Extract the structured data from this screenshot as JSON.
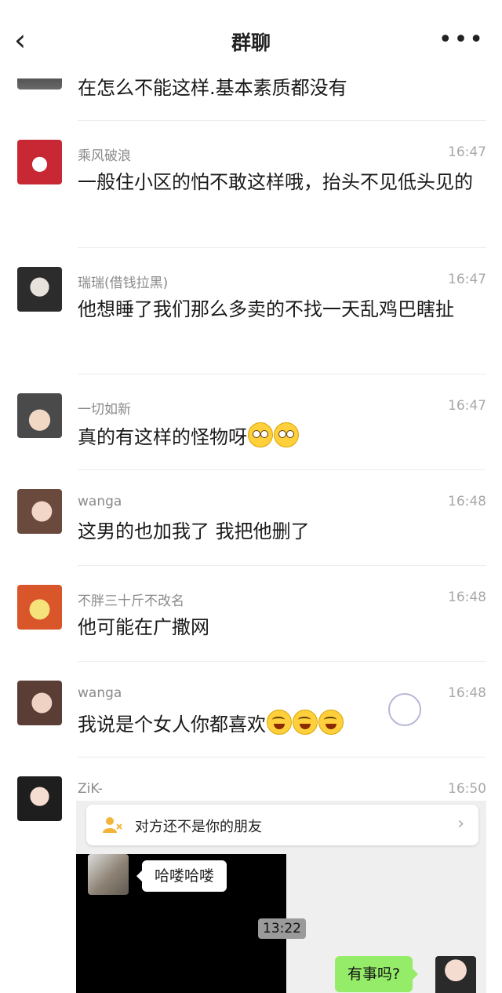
{
  "header": {
    "title": "群聊",
    "back_icon": "chevron-left-icon",
    "more_icon": "more-icon"
  },
  "messages": [
    {
      "nick": "",
      "time": "",
      "text": "在怎么不能这样.基本素质都没有"
    },
    {
      "nick": "乘风破浪",
      "time": "16:47",
      "text": "一般住小区的怕不敢这样哦，抬头不见低头见的"
    },
    {
      "nick": "瑞瑞(借钱拉黑)",
      "time": "16:47",
      "text": "他想睡了我们那么多卖的不找一天乱鸡巴瞎扯"
    },
    {
      "nick": "一切如新",
      "time": "16:47",
      "text": "真的有这样的怪物呀",
      "emoji": "flushed-face-emoji"
    },
    {
      "nick": "wanga",
      "time": "16:48",
      "text": "这男的也加我了 我把他删了"
    },
    {
      "nick": "不胖三十斤不改名",
      "time": "16:48",
      "text": "他可能在广撒网"
    },
    {
      "nick": "wanga",
      "time": "16:48",
      "text": "我说是个女人你都喜欢",
      "emoji": "tears-of-joy-emoji"
    },
    {
      "nick": "ZiK-",
      "time": "16:50",
      "text": ""
    }
  ],
  "screenshot": {
    "notice": "对方还不是你的朋友",
    "left_bubble": "哈喽哈喽",
    "timestamp": "13:22",
    "right_bubble": "有事吗?"
  },
  "colors": {
    "bubble_green": "#95ec69",
    "background": "#ffffff",
    "nick_gray": "#8a8a8a"
  }
}
